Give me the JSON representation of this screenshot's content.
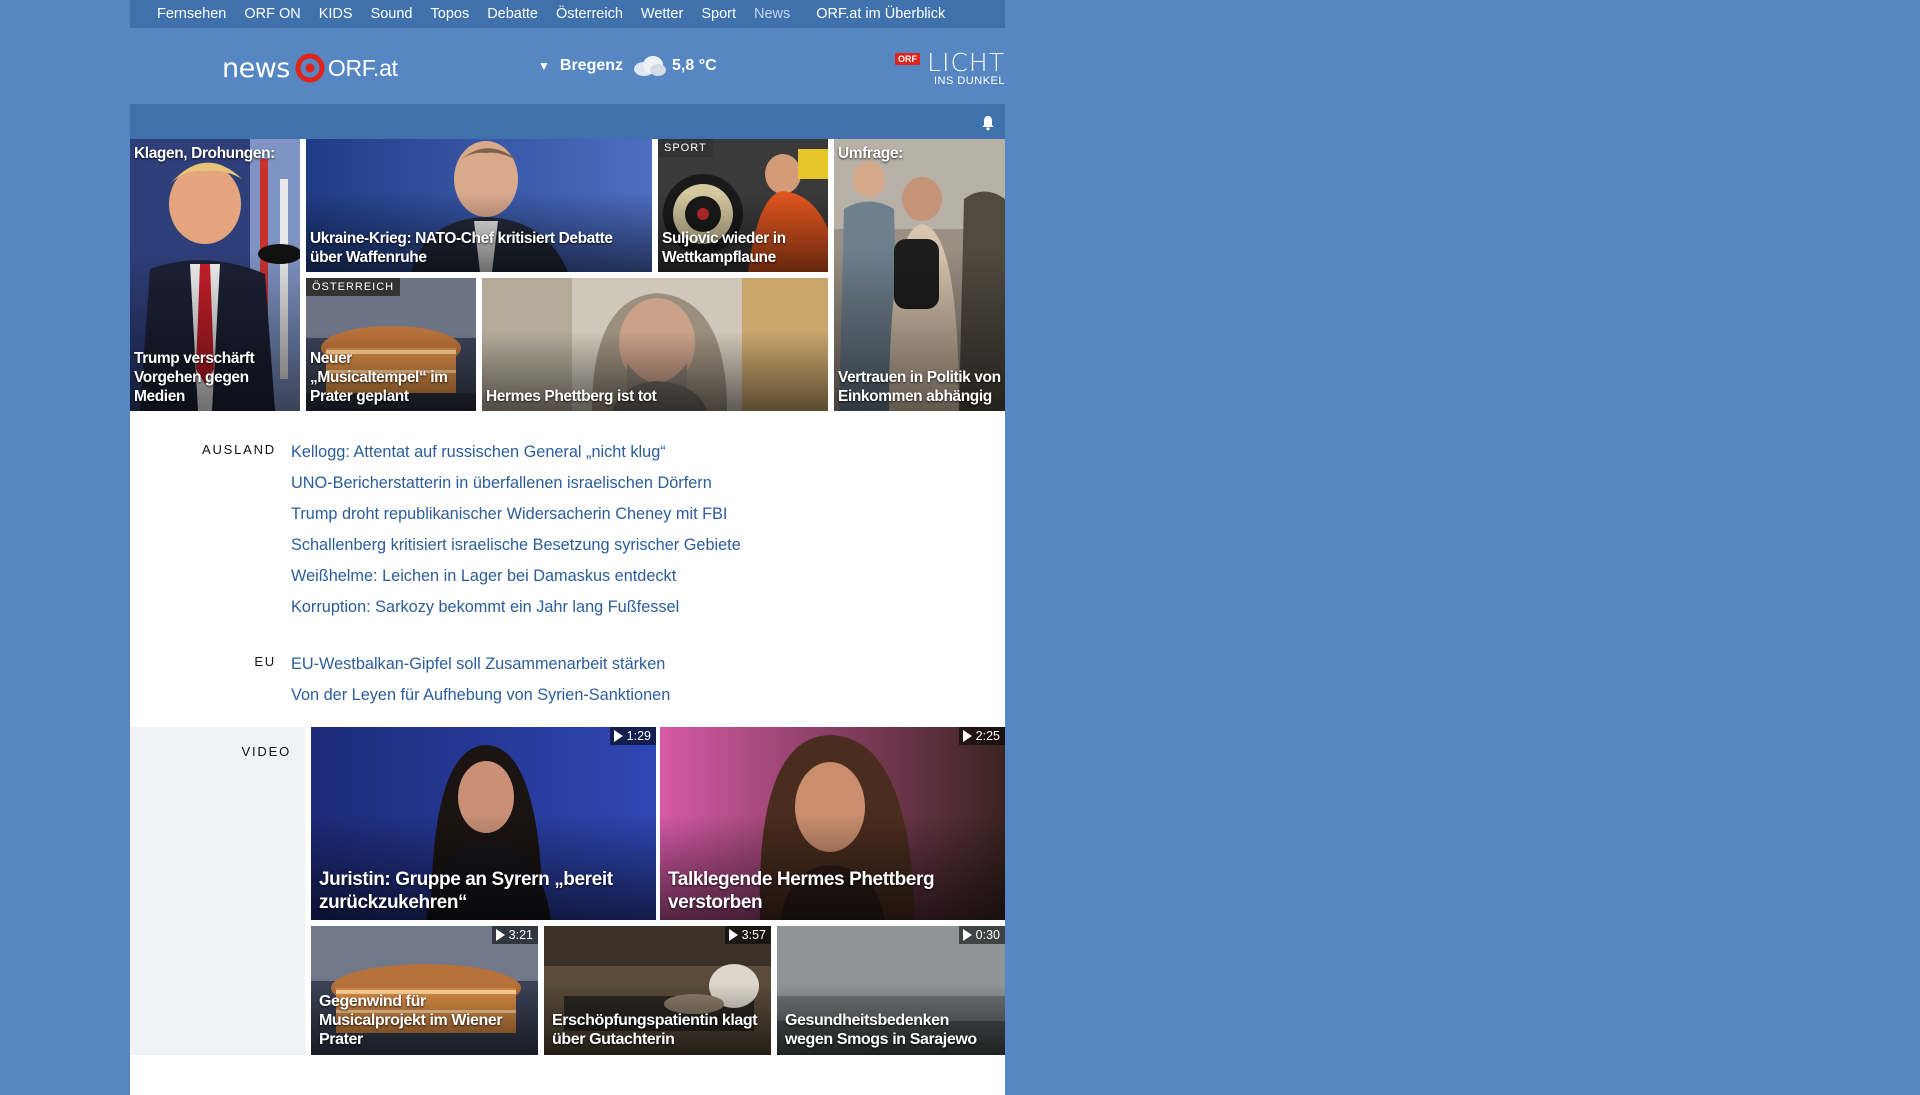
{
  "topnav": {
    "items": [
      {
        "label": "Fernsehen"
      },
      {
        "label": "ORF ON"
      },
      {
        "label": "KIDS"
      },
      {
        "label": "Sound"
      },
      {
        "label": "Topos"
      },
      {
        "label": "Debatte"
      },
      {
        "label": "Österreich"
      },
      {
        "label": "Wetter"
      },
      {
        "label": "Sport"
      },
      {
        "label": "News",
        "active": true
      }
    ],
    "overview": "ORF.at im Überblick"
  },
  "header": {
    "logo_news": "news",
    "logo_orf": "ORF.at",
    "weather_location": "Bregenz",
    "weather_temp": "5,8 °C",
    "weather_icon": "cloud-icon",
    "licht_badge": "ORF",
    "licht_title": "LICHT",
    "licht_subtitle": "INS DUNKEL"
  },
  "tiles": {
    "trump": {
      "top": "Klagen, Drohungen:",
      "title": "Trump verschärft Vorgehen gegen Medien"
    },
    "nato": {
      "title": "Ukraine-Krieg: NATO-Chef kritisiert Debatte über Waffenruhe"
    },
    "sport": {
      "badge": "SPORT",
      "title": "Suljovic wieder in Wettkampflaune"
    },
    "umfrage": {
      "top": "Umfrage:",
      "title": "Vertrauen in Politik von Einkommen abhängig"
    },
    "musical": {
      "badge": "ÖSTERREICH",
      "title": "Neuer „Musicaltempel“ im Prater geplant"
    },
    "hermes": {
      "title": "Hermes Phettberg ist tot"
    }
  },
  "sections": [
    {
      "label": "AUSLAND",
      "links": [
        "Kellogg: Attentat auf russischen General „nicht klug“",
        "UNO-Bericherstatterin in überfallenen israelischen Dörfern",
        "Trump droht republikanischer Widersacherin Cheney mit FBI",
        "Schallenberg kritisiert israelische Besetzung syrischer Gebiete",
        "Weißhelme: Leichen in Lager bei Damaskus entdeckt",
        "Korruption: Sarkozy bekommt ein Jahr lang Fußfessel"
      ]
    },
    {
      "label": "EU",
      "links": [
        "EU-Westbalkan-Gipfel soll Zusammenarbeit stärken",
        "Von der Leyen für Aufhebung von Syrien-Sanktionen"
      ]
    }
  ],
  "video": {
    "label": "VIDEO",
    "items": [
      {
        "title": "Juristin: Gruppe an Syrern „bereit zurückzukehren“",
        "duration": "1:29"
      },
      {
        "title": "Talklegende Hermes Phettberg verstorben",
        "duration": "2:25"
      },
      {
        "title": "Gegenwind für Musicalprojekt im Wiener Prater",
        "duration": "3:21"
      },
      {
        "title": "Erschöpfungspatientin klagt über Gutachterin",
        "duration": "3:57"
      },
      {
        "title": "Gesundheitsbedenken wegen Smogs in Sarajewo",
        "duration": "0:30"
      }
    ]
  }
}
